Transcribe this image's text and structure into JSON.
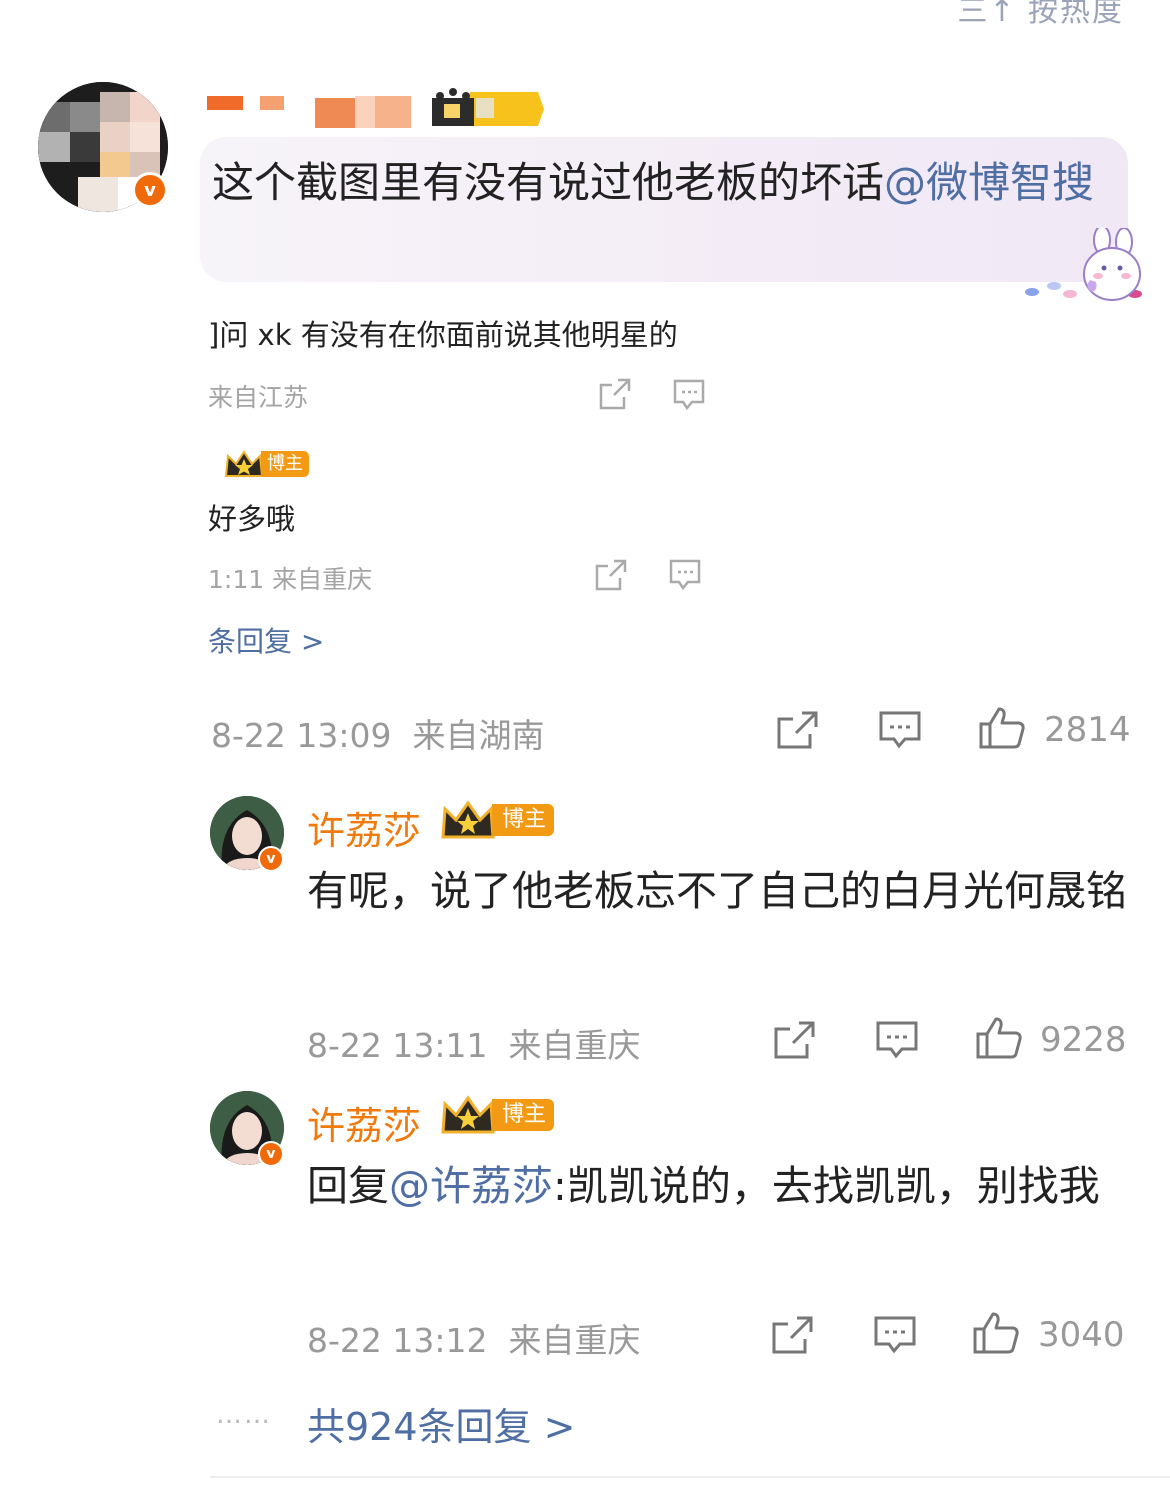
{
  "header": {
    "sort_label": "三↑ 按热度"
  },
  "comment": {
    "text_prefix": "这个截图里有没有说过他老板的坏话",
    "mention": "@微博智搜",
    "time": "8-22 13:09",
    "location": "来自湖南",
    "likes": "2814"
  },
  "embedded": {
    "line1": "]问 xk 有没有在你面前说其他明星的",
    "meta1": "来自江苏",
    "badge": "博主",
    "line2": "好多哦",
    "meta2": "1:11  来自重庆",
    "more": "条回复 >"
  },
  "replies": [
    {
      "name": "许荔莎",
      "badge": "博主",
      "text": "有呢，说了他老板忘不了自己的白月光何晟铭",
      "time": "8-22 13:11",
      "location": "来自重庆",
      "likes": "9228"
    },
    {
      "name": "许荔莎",
      "badge": "博主",
      "text_prefix": "回复",
      "mention": "@许荔莎",
      "text_suffix": ":凯凯说的，去找凯凯，别找我",
      "time": "8-22 13:12",
      "location": "来自重庆",
      "likes": "3040"
    }
  ],
  "footer": {
    "dots": "……",
    "more_replies": "共924条回复 >"
  },
  "colors": {
    "accent_orange": "#f07a0e",
    "link_blue": "#4f6ea4",
    "meta_gray": "#999999"
  }
}
